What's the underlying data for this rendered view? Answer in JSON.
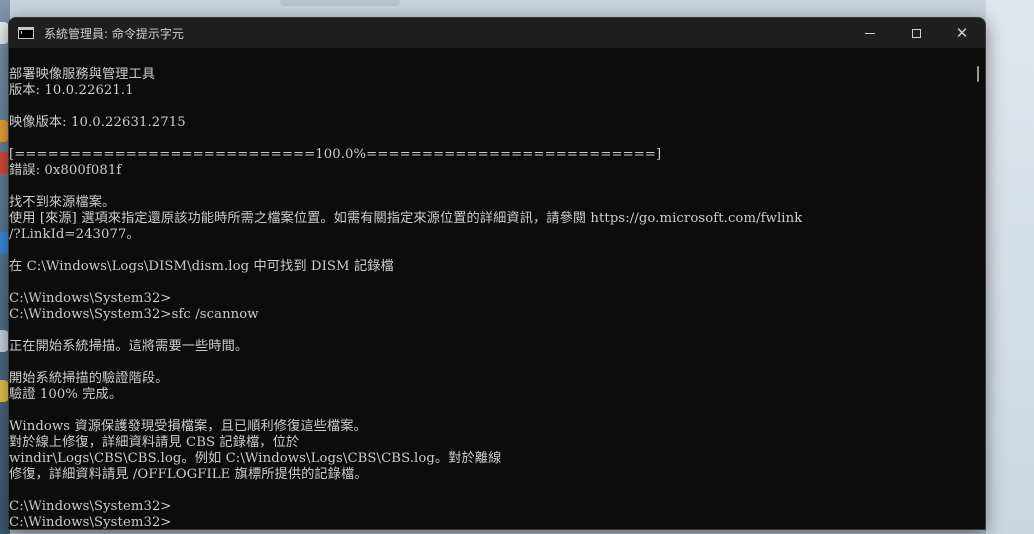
{
  "window": {
    "title": "系統管理員: 命令提示字元",
    "icon": "cmd-icon",
    "controls": {
      "minimize_icon": "minimize-icon",
      "maximize_icon": "maximize-icon",
      "close_icon": "close-icon",
      "close_glyph": "✕"
    }
  },
  "colors": {
    "console_bg": "#0c0c0c",
    "console_text": "#cccccc",
    "titlebar_bg": "#1f1f1f"
  },
  "console": {
    "lines": [
      "",
      "部署映像服務與管理工具",
      "版本: 10.0.22621.1",
      "",
      "映像版本: 10.0.22631.2715",
      "",
      "[===========================100.0%==========================]",
      "錯誤: 0x800f081f",
      "",
      "找不到來源檔案。",
      "使用 [來源] 選項來指定還原該功能時所需之檔案位置。如需有關指定來源位置的詳細資訊，請參閱 https://go.microsoft.com/fwlink",
      "/?LinkId=243077。",
      "",
      "在 C:\\Windows\\Logs\\DISM\\dism.log 中可找到 DISM 記錄檔",
      "",
      "C:\\Windows\\System32>",
      "C:\\Windows\\System32>sfc /scannow",
      "",
      "正在開始系統掃描。這將需要一些時間。",
      "",
      "開始系統掃描的驗證階段。",
      "驗證 100% 完成。",
      "",
      "Windows 資源保護發現受損檔案，且已順利修復這些檔案。",
      "對於線上修復，詳細資料請見 CBS 記錄檔，位於",
      "windir\\Logs\\CBS\\CBS.log。例如 C:\\Windows\\Logs\\CBS\\CBS.log。對於離線",
      "修復，詳細資料請見 /OFFLOGFILE 旗標所提供的記錄檔。",
      "",
      "C:\\Windows\\System32>",
      "C:\\Windows\\System32>"
    ]
  }
}
